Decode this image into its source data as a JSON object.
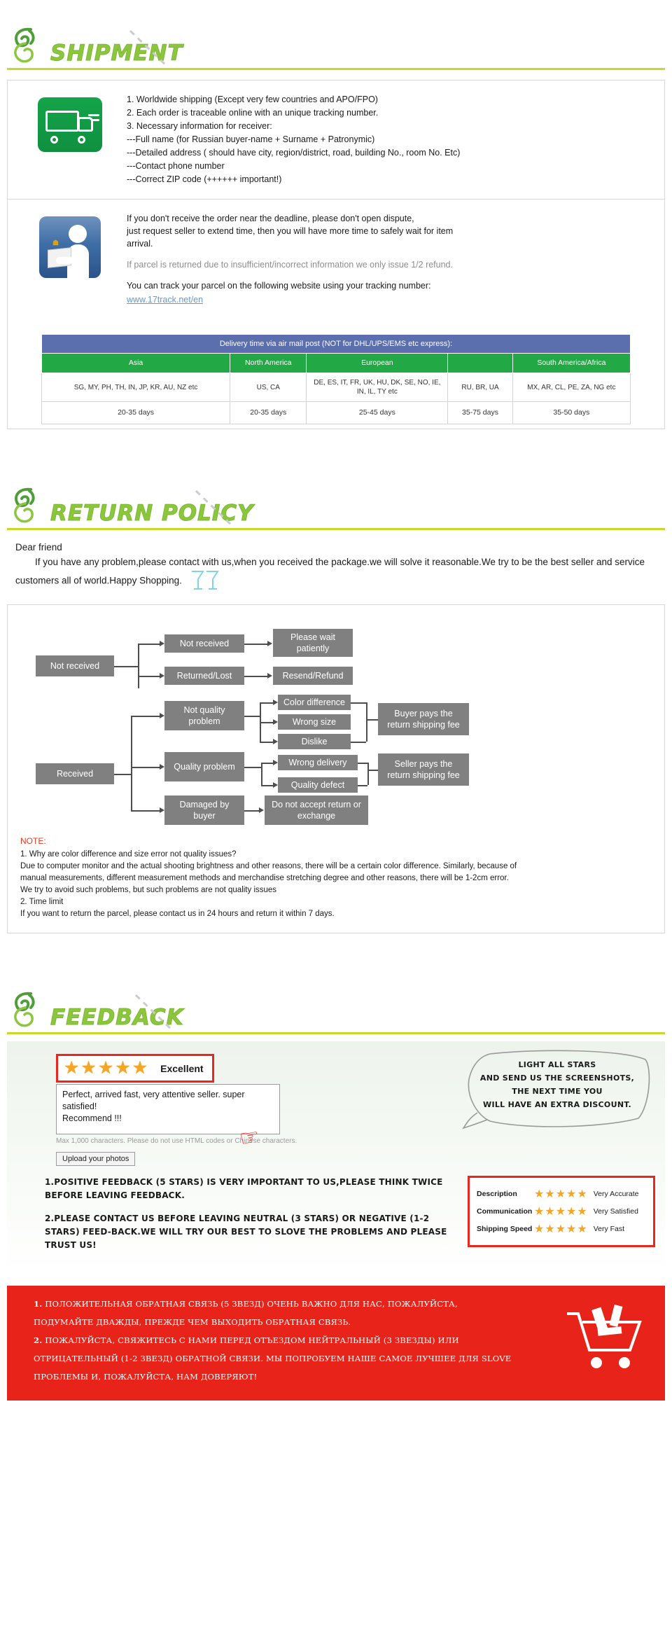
{
  "sections": {
    "shipment": {
      "title": "SHIPMENT",
      "logo_icon": "leaf-logo-icon"
    },
    "return_policy": {
      "title": "RETURN POLICY",
      "logo_icon": "leaf-logo-icon"
    },
    "feedback": {
      "title": "FEEDBACK",
      "logo_icon": "leaf-logo-icon"
    }
  },
  "shipment": {
    "truck_icon": "delivery-truck-icon",
    "info_icon": "parcel-handover-icon",
    "list": [
      "1. Worldwide shipping (Except very few countries and APO/FPO)",
      "2. Each order is traceable online with an unique tracking number.",
      "3. Necessary information for receiver:",
      "---Full name (for Russian buyer-name + Surname + Patronymic)",
      "---Detailed address ( should have city, region/district, road, building No., room No. Etc)",
      "---Contact phone number",
      "---Correct ZIP code (++++++ important!)"
    ],
    "dispute_line1": "If you don't receive the order near the deadline, please don't open dispute,",
    "dispute_line2": "just request seller to extend time, then you will have more time to safely wait for item",
    "dispute_line3": "arrival.",
    "refund_note": "If parcel is returned due to insufficient/incorrect information we only issue 1/2 refund.",
    "track_text": "You can track your parcel on the following website using your tracking number:",
    "track_link": "www.17track.net/en"
  },
  "delivery_table": {
    "title": "Delivery time via air mail post (NOT for DHL/UPS/EMS etc express):",
    "headers": [
      "Asia",
      "North America",
      "European",
      "",
      ""
    ],
    "countries": [
      "SG, MY, PH, TH, IN, JP, KR, AU, NZ etc",
      "US, CA",
      "DE, ES, IT, FR, UK, HU, DK, SE, NO, IE, IN, IL, TY etc",
      "RU, BR, UA",
      "MX, AR, CL, PE, ZA, NG etc"
    ],
    "days": [
      "20-35 days",
      "20-35 days",
      "25-45 days",
      "35-75 days",
      "35-50 days"
    ],
    "header_last": "South America/Africa",
    "header_color": "#22a844",
    "title_color": "#5b6eae"
  },
  "return_policy": {
    "greeting": "Dear friend",
    "intro": "If you have any problem,please contact with us,when you received the package.we will solve it reasonable.We try to be the best seller and service customers all of world.Happy Shopping.",
    "cheers_icon": "cheers-glasses-icon",
    "flow": {
      "not_received": "Not received",
      "received": "Received",
      "b_not_received": "Not received",
      "b_returned_lost": "Returned/Lost",
      "b_not_quality": "Not quality problem",
      "b_quality": "Quality problem",
      "b_damaged": "Damaged by buyer",
      "c_please_wait": "Please wait patiently",
      "c_resend_refund": "Resend/Refund",
      "c_color_diff": "Color difference",
      "c_wrong_size": "Wrong size",
      "c_dislike": "Dislike",
      "c_wrong_delivery": "Wrong delivery",
      "c_quality_defect": "Quality defect",
      "c_no_accept": "Do not accept return or exchange",
      "d_buyer_pays": "Buyer pays the return shipping fee",
      "d_seller_pays": "Seller pays the return shipping fee"
    },
    "note_title": "NOTE:",
    "note_lines": [
      "1. Why are color difference and size error not quality issues?",
      "Due to computer monitor and the actual shooting brightness and other reasons, there will be a certain color difference. Similarly, because of",
      "manual measurements, different measurement methods and merchandise stretching degree and other reasons, there will be 1-2cm error.",
      "We try to avoid such problems, but such problems are not quality issues",
      "2. Time limit",
      "If you want to return the parcel, please contact us in 24 hours and return it within 7 days."
    ]
  },
  "feedback": {
    "stars": "★★★★★",
    "stars_label": "Excellent",
    "review_lines": [
      "Perfect, arrived fast, very attentive seller. super",
      "satisfied!",
      "Recommend !!!"
    ],
    "max_chars": "Max 1,000 characters. Please do not use HTML codes or Chinese characters.",
    "upload_button": "Upload your photos",
    "hand_icon": "pointing-hand-icon",
    "bubble_lines": [
      "LIGHT ALL STARS",
      "AND SEND US THE SCREENSHOTS,",
      "THE NEXT TIME YOU",
      "WILL HAVE AN EXTRA DISCOUNT."
    ],
    "cta_paragraph_1": "1.POSITIVE FEEDBACK (5 STARS) IS VERY IMPORTANT TO US,PLEASE THINK TWICE BEFORE LEAVING FEEDBACK.",
    "cta_paragraph_2": "2.PLEASE CONTACT US BEFORE LEAVING NEUTRAL (3 STARS) OR NEGATIVE (1-2 STARS) FEED-BACK.WE WILL TRY OUR BEST TO SLOVE THE PROBLEMS AND PLEASE TRUST US!",
    "ratings": [
      {
        "label": "Description",
        "stars": "★★★★★",
        "value": "Very Accurate"
      },
      {
        "label": "Communication",
        "stars": "★★★★★",
        "value": "Very Satisfied"
      },
      {
        "label": "Shipping Speed",
        "stars": "★★★★★",
        "value": "Very Fast"
      }
    ],
    "russian": {
      "line1_bold": "1.",
      "line1": " ПОЛОЖИТЕЛЬНАЯ ОБРАТНАЯ СВЯЗЬ (5 ЗВЕЗД) ОЧЕНЬ ВАЖНО ДЛЯ НАС, ПОЖАЛУЙСТА,",
      "line2": "ПОДУМАЙТЕ ДВАЖДЫ, ПРЕЖДЕ ЧЕМ ВЫХОДИТЬ ОБРАТНАЯ СВЯЗЬ.",
      "line3_bold": "2.",
      "line3": " ПОЖАЛУЙСТА, СВЯЖИТЕСЬ С НАМИ ПЕРЕД ОТЪЕЗДОМ НЕЙТРАЛЬНЫЙ (3 ЗВЕЗДЫ) ИЛИ",
      "line4": "ОТРИЦАТЕЛЬНЫЙ (1-2 ЗВЕЗД) ОБРАТНОЙ СВЯЗИ. МЫ ПОПРОБУЕМ НАШЕ САМОЕ ЛУЧШЕЕ ДЛЯ SLOVE",
      "line5": "ПРОБЛЕМЫ И, ПОЖАЛУЙСТА, НАМ ДОВЕРЯЮТ!",
      "cart_icon": "shopping-cart-icon"
    }
  },
  "colors": {
    "brand_green": "#8cc63f",
    "rule": "#c9d92a",
    "red": "#e8231a",
    "star": "#f5a623"
  }
}
